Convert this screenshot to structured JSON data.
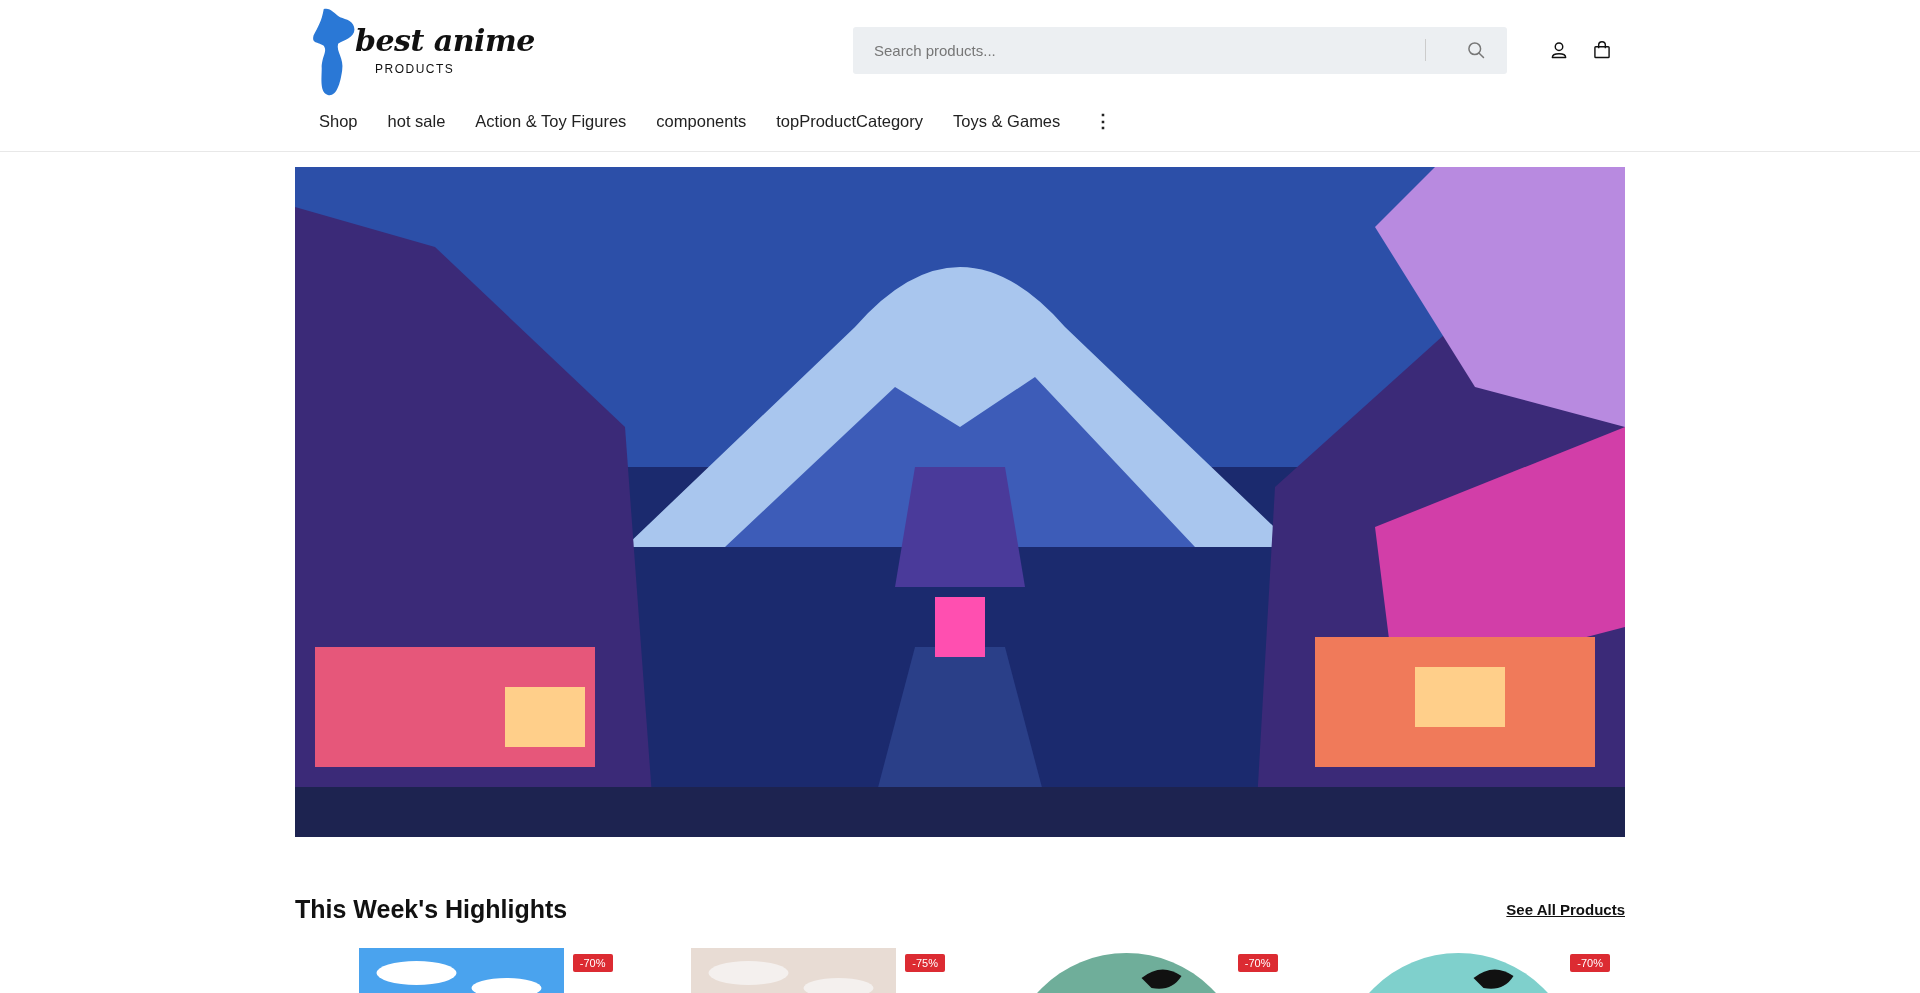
{
  "header": {
    "logo": {
      "title": "best anime",
      "subtitle": "PRODUCTS"
    },
    "search": {
      "placeholder": "Search products..."
    }
  },
  "nav": {
    "items": [
      {
        "label": "Shop"
      },
      {
        "label": "hot sale"
      },
      {
        "label": "Action & Toy Figures"
      },
      {
        "label": "components"
      },
      {
        "label": "topProductCategory"
      },
      {
        "label": "Toys & Games"
      }
    ],
    "more": "⋮"
  },
  "highlights": {
    "title": "This Week's Highlights",
    "link": "See All Products",
    "products": [
      {
        "badge": "-70%",
        "kind": "sky"
      },
      {
        "badge": "-75%",
        "kind": "figure"
      },
      {
        "badge": "-70%",
        "kind": "round"
      },
      {
        "badge": "-70%",
        "kind": "round-light"
      }
    ]
  }
}
